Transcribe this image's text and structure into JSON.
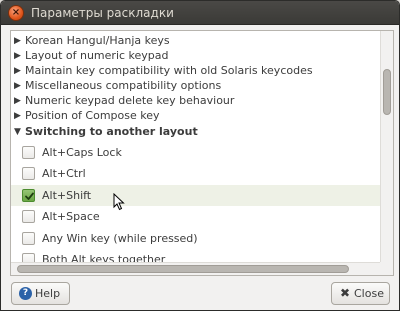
{
  "window": {
    "title": "Параметры раскладки",
    "close_icon": "close-icon"
  },
  "tree": {
    "groups": [
      {
        "label": "Korean Hangul/Hanja keys",
        "expanded": false
      },
      {
        "label": "Layout of numeric keypad",
        "expanded": false
      },
      {
        "label": "Maintain key compatibility with old Solaris keycodes",
        "expanded": false
      },
      {
        "label": "Miscellaneous compatibility options",
        "expanded": false
      },
      {
        "label": "Numeric keypad delete key behaviour",
        "expanded": false
      },
      {
        "label": "Position of Compose key",
        "expanded": false
      },
      {
        "label": "Switching to another layout",
        "expanded": true
      }
    ],
    "options": [
      {
        "label": "Alt+Caps Lock",
        "checked": false
      },
      {
        "label": "Alt+Ctrl",
        "checked": false
      },
      {
        "label": "Alt+Shift",
        "checked": true
      },
      {
        "label": "Alt+Space",
        "checked": false
      },
      {
        "label": "Any Win key (while pressed)",
        "checked": false
      },
      {
        "label": "Both Alt keys together",
        "checked": false
      }
    ]
  },
  "buttons": {
    "help_label": "Help",
    "close_label": "Close"
  },
  "colors": {
    "accent_check": "#6aa644",
    "highlight_row": "#eef1e6",
    "titlebar": "#3b3a37"
  }
}
